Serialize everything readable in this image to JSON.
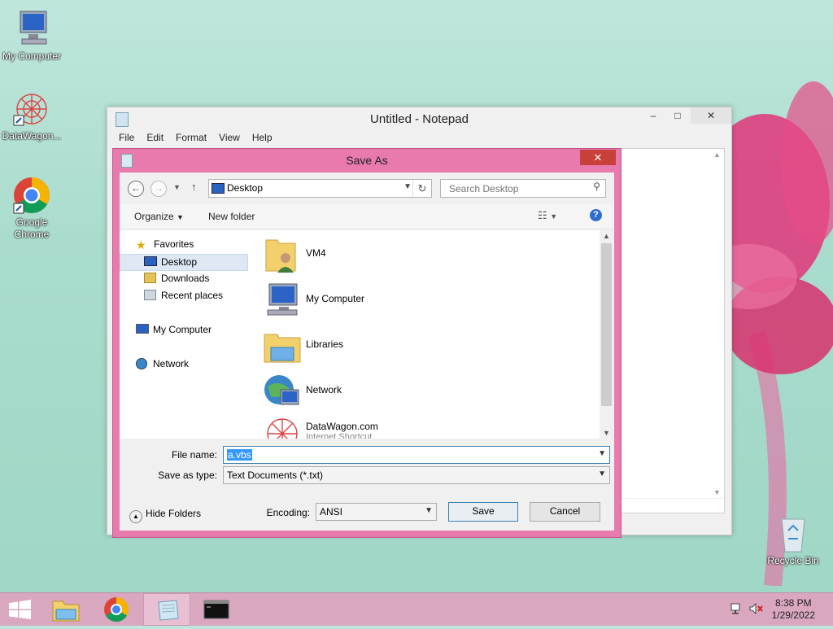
{
  "desktop": {
    "icons": [
      {
        "label": "My Computer",
        "icon": "computer-icon"
      },
      {
        "label": "DataWagon...",
        "icon": "datawagon-icon"
      },
      {
        "label": "Google Chrome",
        "icon": "chrome-icon"
      },
      {
        "label": "Recycle Bin",
        "icon": "recycle-bin-icon"
      }
    ]
  },
  "notepad": {
    "title": "Untitled - Notepad",
    "menu": [
      "File",
      "Edit",
      "Format",
      "View",
      "Help"
    ]
  },
  "dialog": {
    "title": "Save As",
    "address": "Desktop",
    "search_placeholder": "Search Desktop",
    "toolbar": {
      "organize": "Organize",
      "new_folder": "New folder"
    },
    "nav": [
      {
        "label": "Favorites",
        "icon": "star-icon"
      },
      {
        "label": "Desktop",
        "icon": "desktop-icon"
      },
      {
        "label": "Downloads",
        "icon": "downloads-icon"
      },
      {
        "label": "Recent places",
        "icon": "recent-places-icon"
      },
      {
        "label": "My Computer",
        "icon": "computer-icon"
      },
      {
        "label": "Network",
        "icon": "network-icon"
      }
    ],
    "files": [
      {
        "name": "VM4",
        "sub": "",
        "icon": "user-folder-icon"
      },
      {
        "name": "My Computer",
        "sub": "",
        "icon": "computer-icon"
      },
      {
        "name": "Libraries",
        "sub": "",
        "icon": "libraries-icon"
      },
      {
        "name": "Network",
        "sub": "",
        "icon": "network-icon"
      },
      {
        "name": "DataWagon.com",
        "sub": "Internet Shortcut",
        "icon": "datawagon-icon"
      }
    ],
    "file_name_label": "File name:",
    "file_name_value": "a.vbs",
    "save_type_label": "Save as type:",
    "save_type_value": "Text Documents (*.txt)",
    "hide_folders": "Hide Folders",
    "encoding_label": "Encoding:",
    "encoding_value": "ANSI",
    "save_label": "Save",
    "cancel_label": "Cancel"
  },
  "taskbar": {
    "time": "8:38 PM",
    "date": "1/29/2022"
  }
}
